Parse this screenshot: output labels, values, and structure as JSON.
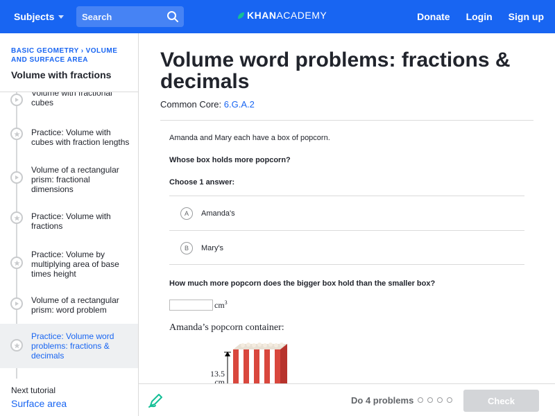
{
  "header": {
    "subjects_label": "Subjects",
    "search_placeholder": "Search",
    "logo_bold": "KHAN",
    "logo_light": "ACADEMY",
    "donate": "Donate",
    "login": "Login",
    "signup": "Sign up",
    "brand_color": "#1865f2"
  },
  "sidebar": {
    "breadcrumb": [
      "BASIC GEOMETRY",
      "VOLUME AND SURFACE AREA"
    ],
    "breadcrumb_part1": "BASIC GEOMETRY",
    "breadcrumb_part2": "VOLUME AND SURFACE AREA",
    "tutorial_title": "Volume with fractions",
    "items": [
      {
        "label": "Volume with fractional cubes",
        "icon": "play-icon",
        "active": false
      },
      {
        "label": "Practice: Volume with cubes with fraction lengths",
        "icon": "star-icon",
        "active": false
      },
      {
        "label": "Volume of a rectangular prism: fractional dimensions",
        "icon": "play-icon",
        "active": false
      },
      {
        "label": "Practice: Volume with fractions",
        "icon": "star-icon",
        "active": false
      },
      {
        "label": "Practice: Volume by multiplying area of base times height",
        "icon": "star-icon",
        "active": false
      },
      {
        "label": "Volume of a rectangular prism: word problem",
        "icon": "play-icon",
        "active": false
      },
      {
        "label": "Practice: Volume word problems: fractions & decimals",
        "icon": "star-icon",
        "active": true
      }
    ],
    "next_label": "Next tutorial",
    "next_link": "Surface area"
  },
  "exercise": {
    "title": "Volume word problems: fractions & decimals",
    "common_core_label": "Common Core:",
    "common_core_code": "6.G.A.2",
    "intro": "Amanda and Mary each have a box of popcorn.",
    "question1": "Whose box holds more popcorn?",
    "choose_label": "Choose 1 answer:",
    "choices": [
      {
        "letter": "A",
        "text": "Amanda's"
      },
      {
        "letter": "B",
        "text": "Mary's"
      }
    ],
    "question2": "How much more popcorn does the bigger box hold than the smaller box?",
    "answer_value": "",
    "unit": "cm",
    "unit_exp": "3",
    "figure_label": "Amanda’s popcorn container:",
    "dim_value": "13.5",
    "dim_unit": "cm"
  },
  "footer": {
    "do_problems": "Do 4 problems",
    "check_label": "Check",
    "progress_total": 4,
    "progress_done": 0
  }
}
